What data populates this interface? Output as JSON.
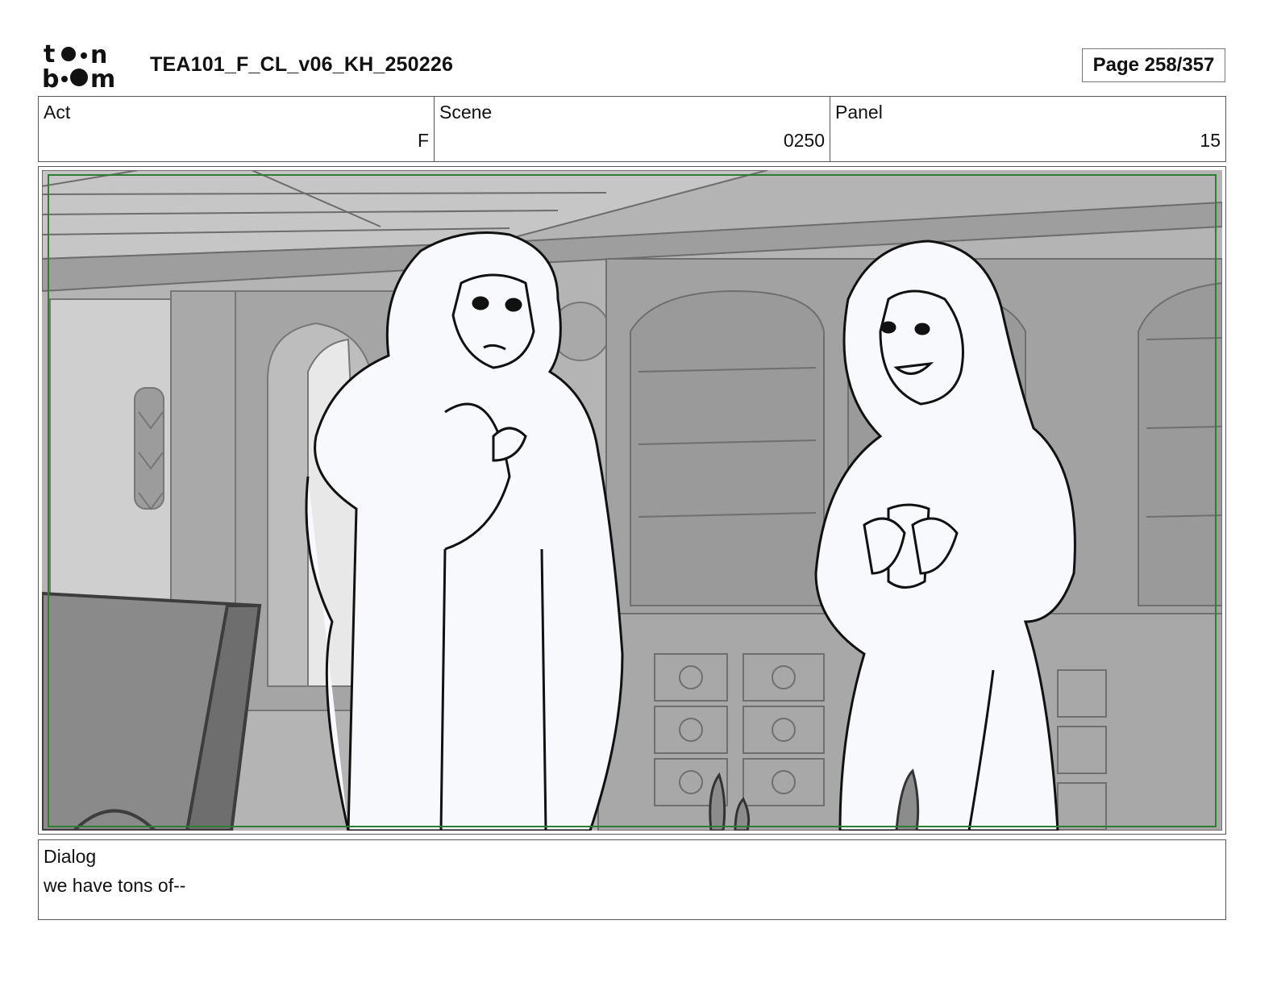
{
  "header": {
    "logo_text": "toon boom",
    "title": "TEA101_F_CL_v06_KH_250226",
    "page": "Page 258/357"
  },
  "info": {
    "act": {
      "label": "Act",
      "value": "F"
    },
    "scene": {
      "label": "Scene",
      "value": "0250"
    },
    "panel": {
      "label": "Panel",
      "value": "15"
    }
  },
  "dialog": {
    "label": "Dialog",
    "text": "we have tons of--"
  },
  "colors": {
    "safe_frame": "#2e7d32",
    "background_wash": "#b9b9b9",
    "character_fill": "#f8f9fc"
  }
}
